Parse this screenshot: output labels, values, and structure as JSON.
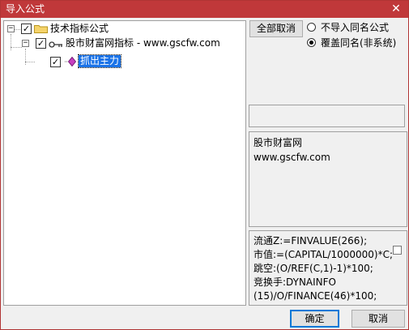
{
  "window": {
    "title": "导入公式",
    "close_glyph": "✕"
  },
  "tree": {
    "nodes": [
      {
        "label": "技术指标公式",
        "checked": true,
        "expander": "−",
        "icon": "folder-icon"
      },
      {
        "label": "股市财富网指标 - www.gscfw.com",
        "checked": true,
        "expander": "−",
        "icon": "key-icon"
      },
      {
        "label": "抓出主力",
        "checked": true,
        "selected": true,
        "icon": "gem-icon"
      }
    ],
    "check_glyph": "✓"
  },
  "options": {
    "deselect_all_label": "全部取消",
    "radio_options": [
      {
        "label": "不导入同名公式",
        "checked": false
      },
      {
        "label": "覆盖同名(非系统)",
        "checked": true
      }
    ]
  },
  "description": {
    "lines": [
      "股市财富网",
      "www.gscfw.com"
    ]
  },
  "formula": {
    "lines": [
      "流通Z:=FINVALUE(266);",
      "市值:=(CAPITAL/1000000)*C;",
      "跳空:(O/REF(C,1)-1)*100;",
      "竞换手:DYNAINFO",
      "(15)/O/FINANCE(46)*100;"
    ]
  },
  "footer": {
    "ok_label": "确定",
    "cancel_label": "取消"
  },
  "colors": {
    "titlebar": "#c0383a",
    "selection": "#1a73e8",
    "folder": "#f5d36a",
    "gem": "#c840c0"
  }
}
